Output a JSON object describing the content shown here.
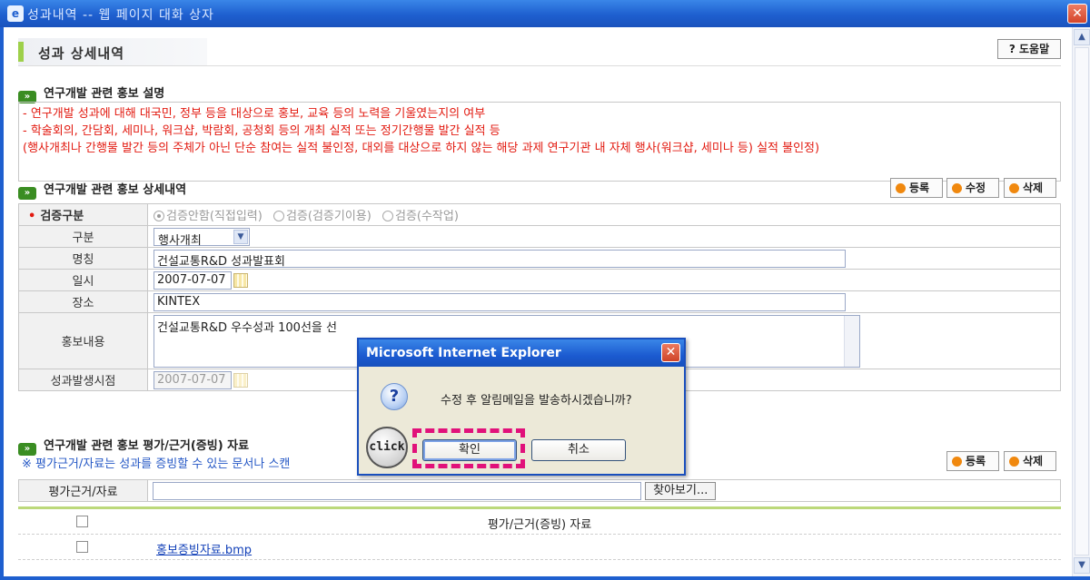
{
  "window": {
    "title": "성과내역 -- 웹 페이지 대화 상자",
    "close": "✕"
  },
  "page": {
    "title": "성과 상세내역",
    "help": "? 도움말"
  },
  "desc": {
    "heading": "연구개발 관련 홍보 설명",
    "lines": [
      "- 연구개발 성과에 대해 대국민, 정부 등을 대상으로 홍보, 교육 등의 노력을 기울였는지의 여부",
      "- 학술회의, 간담회, 세미나, 워크샵, 박람회, 공청회 등의 개최 실적 또는 정기간행물 발간 실적 등",
      "(행사개최나 간행물 발간 등의 주체가 아닌 단순 참여는 실적 불인정, 대외를 대상으로 하지 않는 해당 과제 연구기관 내 자체 행사(워크샵, 세미나 등) 실적 불인정)"
    ]
  },
  "detail": {
    "heading": "연구개발 관련 홍보 상세내역",
    "buttons": {
      "register": "등록",
      "edit": "수정",
      "delete": "삭제"
    },
    "verify_label": "검증구분",
    "verify_options": [
      "검증안함(직접입력)",
      "검증(검증기이용)",
      "검증(수작업)"
    ],
    "type_label": "구분",
    "type_value": "행사개최",
    "name_label": "명칭",
    "name_value": "건설교통R&D 성과발표회",
    "date_label": "일시",
    "date_value": "2007-07-07",
    "place_label": "장소",
    "place_value": "KINTEX",
    "content_label": "홍보내용",
    "content_value": "건설교통R&D 우수성과 100선을 선",
    "occur_label": "성과발생시점",
    "occur_value": "2007-07-07"
  },
  "evidence": {
    "heading": "연구개발 관련 홍보 평가/근거(증빙) 자료",
    "note": "※ 평가근거/자료는 성과를 증빙할 수 있는 문서나 스캔",
    "buttons": {
      "register": "등록",
      "delete": "삭제"
    },
    "label": "평가근거/자료",
    "browse": "찾아보기...",
    "list_header": "평가/근거(증빙) 자료",
    "files": [
      "홍보증빙자료.bmp"
    ]
  },
  "dialog": {
    "title": "Microsoft Internet Explorer",
    "message": "수정 후 알림메일을 발송하시겠습니까?",
    "ok": "확인",
    "cancel": "취소"
  },
  "annotation": {
    "click": "click"
  }
}
